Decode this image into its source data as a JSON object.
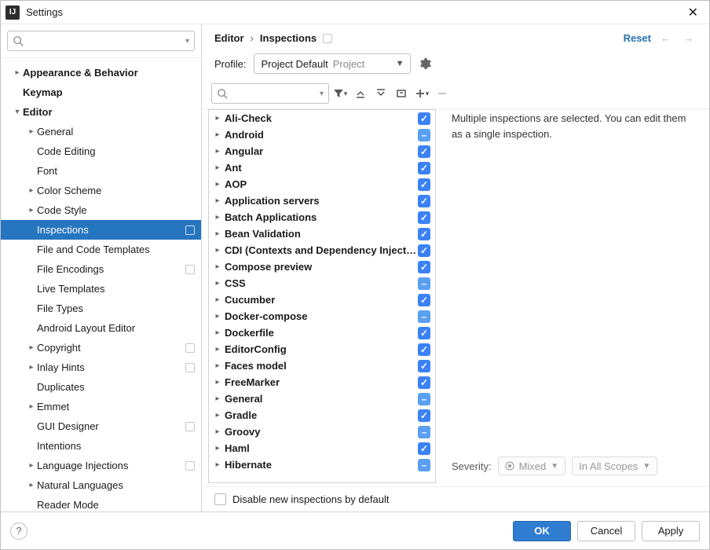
{
  "window": {
    "title": "Settings"
  },
  "sidebar_search": {
    "value": ""
  },
  "sidebar": [
    {
      "label": "Appearance & Behavior",
      "depth": 0,
      "expand": "right",
      "bold": true
    },
    {
      "label": "Keymap",
      "depth": 0,
      "expand": "none",
      "bold": true
    },
    {
      "label": "Editor",
      "depth": 0,
      "expand": "down",
      "bold": true
    },
    {
      "label": "General",
      "depth": 1,
      "expand": "right"
    },
    {
      "label": "Code Editing",
      "depth": 1,
      "expand": "none"
    },
    {
      "label": "Font",
      "depth": 1,
      "expand": "none"
    },
    {
      "label": "Color Scheme",
      "depth": 1,
      "expand": "right"
    },
    {
      "label": "Code Style",
      "depth": 1,
      "expand": "right"
    },
    {
      "label": "Inspections",
      "depth": 1,
      "expand": "none",
      "selected": true,
      "tag": true
    },
    {
      "label": "File and Code Templates",
      "depth": 1,
      "expand": "none"
    },
    {
      "label": "File Encodings",
      "depth": 1,
      "expand": "none",
      "tag": true
    },
    {
      "label": "Live Templates",
      "depth": 1,
      "expand": "none"
    },
    {
      "label": "File Types",
      "depth": 1,
      "expand": "none"
    },
    {
      "label": "Android Layout Editor",
      "depth": 1,
      "expand": "none"
    },
    {
      "label": "Copyright",
      "depth": 1,
      "expand": "right",
      "tag": true
    },
    {
      "label": "Inlay Hints",
      "depth": 1,
      "expand": "right",
      "tag": true
    },
    {
      "label": "Duplicates",
      "depth": 1,
      "expand": "none"
    },
    {
      "label": "Emmet",
      "depth": 1,
      "expand": "right"
    },
    {
      "label": "GUI Designer",
      "depth": 1,
      "expand": "none",
      "tag": true
    },
    {
      "label": "Intentions",
      "depth": 1,
      "expand": "none"
    },
    {
      "label": "Language Injections",
      "depth": 1,
      "expand": "right",
      "tag": true
    },
    {
      "label": "Natural Languages",
      "depth": 1,
      "expand": "right"
    },
    {
      "label": "Reader Mode",
      "depth": 1,
      "expand": "none"
    }
  ],
  "breadcrumb": {
    "a": "Editor",
    "b": "Inspections"
  },
  "reset_label": "Reset",
  "profile": {
    "label": "Profile:",
    "value": "Project Default",
    "hint": "Project"
  },
  "insp_search": {
    "value": ""
  },
  "inspections": [
    {
      "name": "Ali-Check",
      "state": "checked"
    },
    {
      "name": "Android",
      "state": "mixed"
    },
    {
      "name": "Angular",
      "state": "checked"
    },
    {
      "name": "Ant",
      "state": "checked"
    },
    {
      "name": "AOP",
      "state": "checked"
    },
    {
      "name": "Application servers",
      "state": "checked"
    },
    {
      "name": "Batch Applications",
      "state": "checked"
    },
    {
      "name": "Bean Validation",
      "state": "checked"
    },
    {
      "name": "CDI (Contexts and Dependency Injection)",
      "state": "checked"
    },
    {
      "name": "Compose preview",
      "state": "checked"
    },
    {
      "name": "CSS",
      "state": "mixed"
    },
    {
      "name": "Cucumber",
      "state": "checked"
    },
    {
      "name": "Docker-compose",
      "state": "mixed"
    },
    {
      "name": "Dockerfile",
      "state": "checked"
    },
    {
      "name": "EditorConfig",
      "state": "checked"
    },
    {
      "name": "Faces model",
      "state": "checked"
    },
    {
      "name": "FreeMarker",
      "state": "checked"
    },
    {
      "name": "General",
      "state": "mixed"
    },
    {
      "name": "Gradle",
      "state": "checked"
    },
    {
      "name": "Groovy",
      "state": "mixed"
    },
    {
      "name": "Haml",
      "state": "checked"
    },
    {
      "name": "Hibernate",
      "state": "mixed"
    }
  ],
  "detail": {
    "description": "Multiple inspections are selected. You can edit them as a single inspection."
  },
  "severity": {
    "label": "Severity:",
    "value": "Mixed",
    "scope": "In All Scopes"
  },
  "disable_cb": {
    "label": "Disable new inspections by default",
    "checked": false
  },
  "buttons": {
    "ok": "OK",
    "cancel": "Cancel",
    "apply": "Apply"
  }
}
